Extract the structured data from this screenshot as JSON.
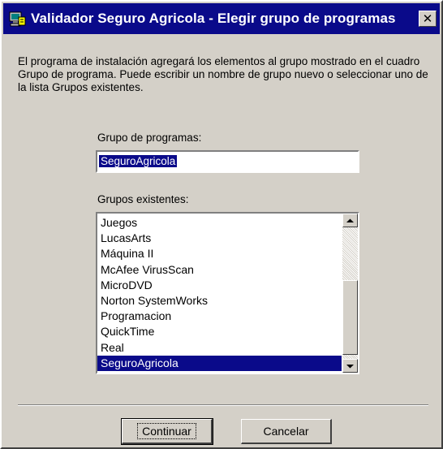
{
  "window": {
    "title": "Validador Seguro Agricola - Elegir grupo de programas",
    "close_label": "✕"
  },
  "description": "El programa de instalación agregará los elementos al grupo mostrado en el cuadro Grupo de programa. Puede escribir un nombre de grupo nuevo o seleccionar uno de la lista Grupos existentes.",
  "group_field": {
    "label": "Grupo de programas:",
    "value": "SeguroAgricola"
  },
  "existing_groups": {
    "label": "Grupos existentes:",
    "items": [
      "Juegos",
      "LucasArts",
      "Máquina II",
      "McAfee VirusScan",
      "MicroDVD",
      "Norton SystemWorks",
      "Programacion",
      "QuickTime",
      "Real",
      "SeguroAgricola"
    ],
    "selected": "SeguroAgricola"
  },
  "buttons": {
    "continue_label": "Continuar",
    "cancel_label": "Cancelar"
  },
  "icons": {
    "title": "setup-computer-icon",
    "close": "close-icon",
    "scroll_up": "scroll-up-arrow-icon",
    "scroll_down": "scroll-down-arrow-icon"
  },
  "colors": {
    "titlebar": "#0a0a8a",
    "window_face": "#d4d0c8",
    "selection": "#0a0a8a"
  }
}
